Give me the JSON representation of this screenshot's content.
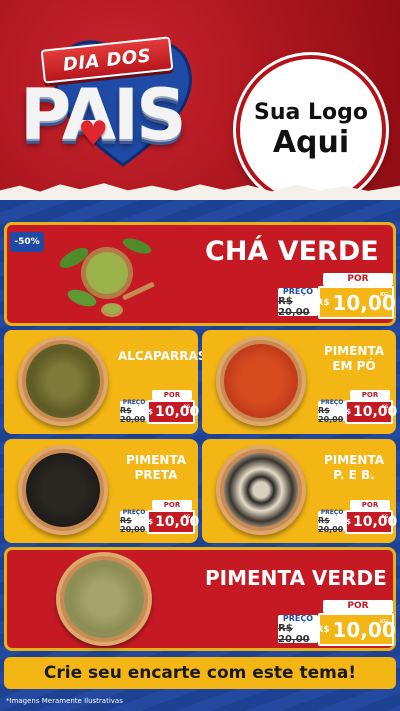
{
  "header": {
    "banner": "DIA DOS",
    "title": "PAIS",
    "logo_line1": "Sua Logo",
    "logo_line2": "Aqui"
  },
  "discount_badge": "-50%",
  "products": [
    {
      "name": "CHÁ VERDE",
      "por": "POR",
      "preco_label": "PREÇO",
      "old_price": "R$ 20,00",
      "currency": "R$",
      "price": "10,00",
      "unit": "KG"
    },
    {
      "name": "ALCAPARRAS",
      "por": "POR",
      "preco_label": "PREÇO",
      "old_price": "R$ 20,00",
      "currency": "R$",
      "price": "10,00",
      "unit": "KG"
    },
    {
      "name": "PIMENTA EM PÓ",
      "name_l1": "PIMENTA",
      "name_l2": "EM PÓ",
      "por": "POR",
      "preco_label": "PREÇO",
      "old_price": "R$ 20,00",
      "currency": "R$",
      "price": "10,00",
      "unit": "KG"
    },
    {
      "name": "PIMENTA PRETA",
      "name_l1": "PIMENTA",
      "name_l2": "PRETA",
      "por": "POR",
      "preco_label": "PREÇO",
      "old_price": "R$ 20,00",
      "currency": "R$",
      "price": "10,00",
      "unit": "KG"
    },
    {
      "name": "PIMENTA P. E B.",
      "name_l1": "PIMENTA",
      "name_l2": "P. E B.",
      "por": "POR",
      "preco_label": "PREÇO",
      "old_price": "R$ 20,00",
      "currency": "R$",
      "price": "10,00",
      "unit": "KG"
    },
    {
      "name": "PIMENTA VERDE",
      "por": "POR",
      "preco_label": "PREÇO",
      "old_price": "R$ 20,00",
      "currency": "R$",
      "price": "10,00",
      "unit": "KG"
    }
  ],
  "cta": "Crie seu encarte com este tema!",
  "footnote": "*Imagens Meramente Ilustrativas",
  "colors": {
    "red": "#c51a24",
    "yellow": "#f3b614",
    "blue": "#1f4aa6"
  }
}
